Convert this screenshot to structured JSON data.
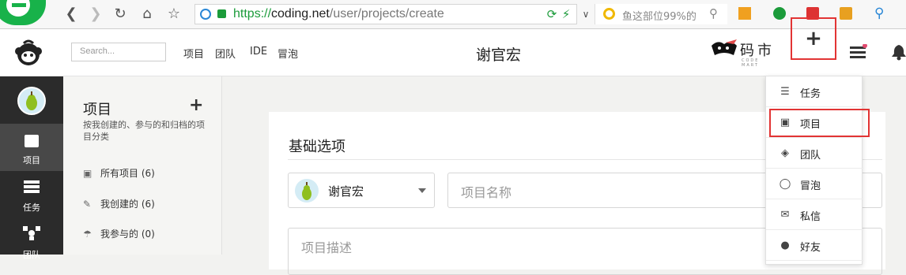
{
  "browser": {
    "url_scheme": "https://",
    "url_host": "coding.net",
    "url_path": "/user/projects/create",
    "search_text": "鱼这部位99%的"
  },
  "header": {
    "search_placeholder": "Search...",
    "nav": [
      "项目",
      "团队",
      "IDE",
      "冒泡"
    ],
    "username": "谢官宏",
    "codemart_text": "码市",
    "codemart_sub": "CODE MART",
    "plus_label": "+"
  },
  "icon_sidebar": {
    "items": [
      {
        "label": "项目",
        "icon": "project-icon"
      },
      {
        "label": "任务",
        "icon": "task-icon"
      },
      {
        "label": "团队",
        "icon": "team-icon"
      }
    ]
  },
  "project_sidebar": {
    "title": "项目",
    "add_label": "+",
    "description": "按我创建的、参与的和归档的项目分类",
    "filters": [
      {
        "label": "所有项目 (6)",
        "icon": "project-icon"
      },
      {
        "label": "我创建的 (6)",
        "icon": "edit-icon"
      },
      {
        "label": "我参与的 (0)",
        "icon": "umbrella-icon"
      }
    ]
  },
  "main": {
    "section_title": "基础选项",
    "owner_name": "谢官宏",
    "project_name_placeholder": "项目名称",
    "description_placeholder": "项目描述"
  },
  "dropdown": {
    "items": [
      {
        "label": "任务",
        "icon": "task-icon"
      },
      {
        "label": "项目",
        "icon": "project-icon"
      },
      {
        "label": "团队",
        "icon": "team-icon"
      },
      {
        "label": "冒泡",
        "icon": "bubble-icon"
      },
      {
        "label": "私信",
        "icon": "mail-icon"
      },
      {
        "label": "好友",
        "icon": "user-icon"
      }
    ]
  },
  "colors": {
    "accent_green": "#18b24a",
    "highlight_red": "#e23434",
    "sidebar_dark": "#2b2b2b"
  }
}
